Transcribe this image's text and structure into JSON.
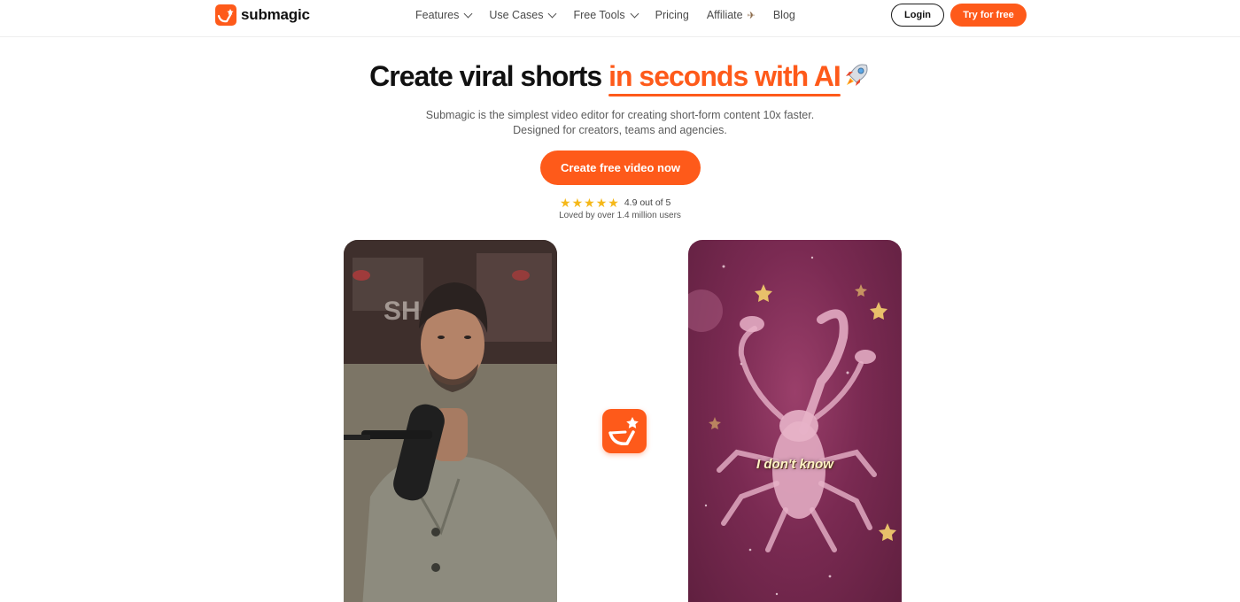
{
  "brand": {
    "name": "submagic",
    "accent": "#fe5a1a"
  },
  "nav": {
    "items": [
      {
        "label": "Features",
        "dropdown": true
      },
      {
        "label": "Use Cases",
        "dropdown": true
      },
      {
        "label": "Free Tools",
        "dropdown": true
      },
      {
        "label": "Pricing",
        "dropdown": false
      },
      {
        "label": "Affiliate",
        "dropdown": false,
        "icon": "paper-plane-icon"
      },
      {
        "label": "Blog",
        "dropdown": false
      }
    ],
    "login_label": "Login",
    "try_label": "Try for free"
  },
  "hero": {
    "title_main": "Create viral shorts",
    "title_accent": "in seconds with AI",
    "title_icon": "rocket-icon",
    "subtitle_line1": "Submagic is the simplest video editor for creating short-form content 10x faster.",
    "subtitle_line2": "Designed for creators, teams and agencies.",
    "cta_label": "Create free video now",
    "rating_text": "4.9 out of 5",
    "rating_value": 4.9,
    "rating_max": 5,
    "loved_text": "Loved by over 1.4 million users"
  },
  "videos": {
    "left": {
      "icon": "podcast-video-thumbnail"
    },
    "center_icon": "submagic-logo-icon",
    "right": {
      "icon": "scorpion-video-thumbnail",
      "caption": "I don't know"
    }
  }
}
